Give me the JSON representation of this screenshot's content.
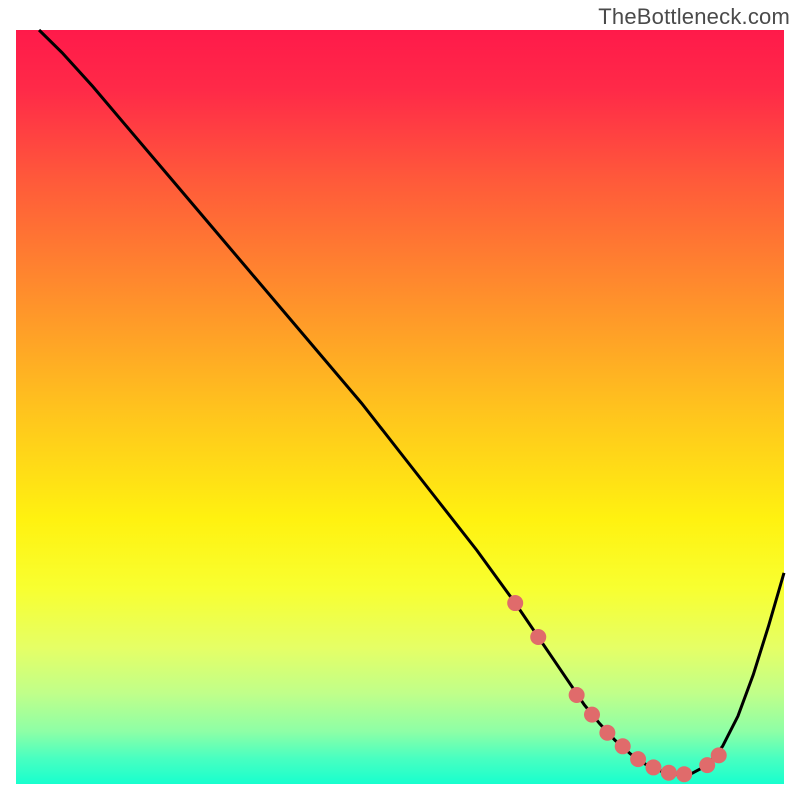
{
  "watermark": "TheBottleneck.com",
  "chart_data": {
    "type": "line",
    "title": "",
    "xlabel": "",
    "ylabel": "",
    "xlim": [
      0,
      100
    ],
    "ylim": [
      0,
      100
    ],
    "background_gradient": {
      "stops": [
        {
          "offset": 0.0,
          "color": "#ff1a4a"
        },
        {
          "offset": 0.08,
          "color": "#ff2a48"
        },
        {
          "offset": 0.2,
          "color": "#ff5a3a"
        },
        {
          "offset": 0.35,
          "color": "#ff8e2c"
        },
        {
          "offset": 0.5,
          "color": "#ffc21e"
        },
        {
          "offset": 0.65,
          "color": "#fff210"
        },
        {
          "offset": 0.74,
          "color": "#f8ff30"
        },
        {
          "offset": 0.82,
          "color": "#e5ff66"
        },
        {
          "offset": 0.88,
          "color": "#c0ff8a"
        },
        {
          "offset": 0.93,
          "color": "#8effa6"
        },
        {
          "offset": 0.965,
          "color": "#4affc0"
        },
        {
          "offset": 1.0,
          "color": "#18ffce"
        }
      ]
    },
    "series": [
      {
        "name": "bottleneck-curve",
        "color": "#000000",
        "x": [
          3,
          6,
          10,
          15,
          20,
          25,
          30,
          35,
          40,
          45,
          50,
          55,
          60,
          65,
          68,
          70,
          72,
          74,
          76,
          78,
          80,
          82,
          84,
          86,
          88,
          90,
          92,
          94,
          96,
          98,
          100
        ],
        "y": [
          100,
          97,
          92.5,
          86.5,
          80.5,
          74.5,
          68.5,
          62.5,
          56.5,
          50.5,
          44.0,
          37.5,
          31.0,
          24.0,
          19.5,
          16.5,
          13.5,
          10.5,
          8.0,
          5.8,
          4.0,
          2.6,
          1.7,
          1.3,
          1.4,
          2.5,
          5.0,
          9.0,
          14.5,
          21.0,
          28.0
        ]
      }
    ],
    "markers": {
      "name": "highlight-points",
      "color": "#e06b6b",
      "radius": 8,
      "x": [
        65,
        68,
        73,
        75,
        77,
        79,
        81,
        83,
        85,
        87,
        90,
        91.5
      ],
      "y": [
        24,
        19.5,
        11.8,
        9.2,
        6.8,
        5.0,
        3.3,
        2.2,
        1.5,
        1.3,
        2.5,
        3.8
      ]
    }
  }
}
